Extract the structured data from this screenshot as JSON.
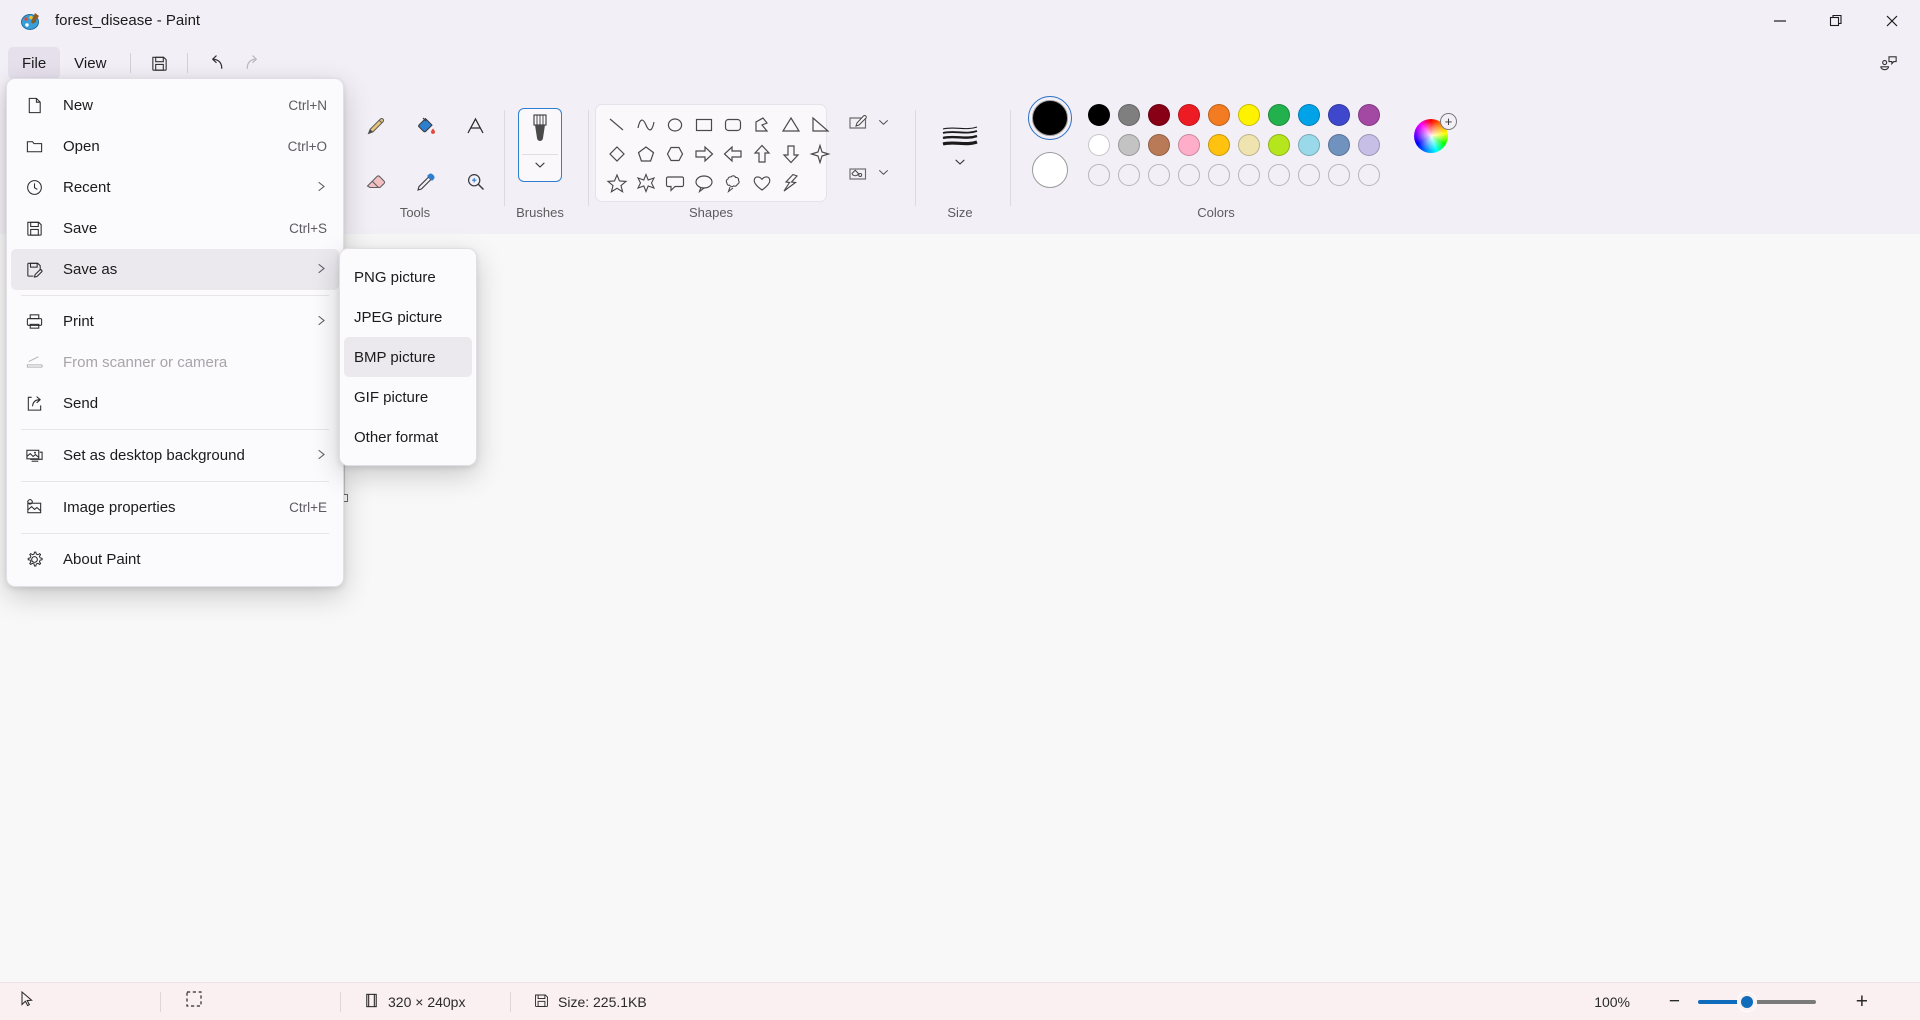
{
  "window": {
    "title": "forest_disease - Paint",
    "app_icon": "paint-palette-icon",
    "minimize": "—",
    "maximize": "❐",
    "close": "✕"
  },
  "menubar": {
    "tabs": [
      {
        "label": "File",
        "active": true
      },
      {
        "label": "View",
        "active": false
      }
    ],
    "quick_access": [
      {
        "name": "save-icon",
        "enabled": true
      },
      {
        "name": "undo-icon",
        "enabled": true
      },
      {
        "name": "redo-icon",
        "enabled": false
      }
    ],
    "feedback": "feedback-icon"
  },
  "ribbon": {
    "groups": [
      {
        "label": "Tools"
      },
      {
        "label": "Brushes"
      },
      {
        "label": "Shapes"
      },
      {
        "label": "Size"
      },
      {
        "label": "Colors"
      }
    ],
    "tools": [
      {
        "name": "pencil-icon",
        "label": "Pencil"
      },
      {
        "name": "fill-bucket-icon",
        "label": "Fill with color"
      },
      {
        "name": "text-icon",
        "label": "Text"
      },
      {
        "name": "eraser-icon",
        "label": "Eraser"
      },
      {
        "name": "color-picker-icon",
        "label": "Color picker"
      },
      {
        "name": "magnifier-icon",
        "label": "Magnifier"
      }
    ],
    "brushes": {
      "name": "brush-icon",
      "label": "Brushes",
      "expand": "chevron-down-icon"
    },
    "shapes": [
      "line",
      "curve",
      "oval",
      "rectangle",
      "rounded-rectangle",
      "polygon",
      "triangle",
      "right-triangle",
      "diamond",
      "pentagon",
      "hexagon",
      "right-arrow",
      "left-arrow",
      "up-arrow",
      "down-arrow",
      "four-point-star",
      "five-point-star",
      "six-point-star",
      "rounded-callout",
      "oval-callout",
      "cloud-callout",
      "heart",
      "lightning"
    ],
    "shape_options": [
      {
        "name": "outline-icon",
        "expand": "chevron-down-icon"
      },
      {
        "name": "fill-icon",
        "expand": "chevron-down-icon"
      }
    ],
    "size": {
      "name": "size-icon",
      "expand": "chevron-down-icon",
      "label": "Size"
    },
    "colors": {
      "primary": "#000000",
      "secondary": "#ffffff",
      "row1": [
        "#000000",
        "#7f7f7f",
        "#880015",
        "#ed1c24",
        "#f37b21",
        "#fff200",
        "#22b14c",
        "#00a2e8",
        "#3f48cc",
        "#a349a4"
      ],
      "row2": [
        "#ffffff",
        "#c3c3c3",
        "#b97a57",
        "#ffaec9",
        "#ffc20e",
        "#efe4b0",
        "#b5e61d",
        "#99d9ea",
        "#7092be",
        "#c8bfe7"
      ],
      "row3": [
        "",
        "",
        "",
        "",
        "",
        "",
        "",
        "",
        "",
        ""
      ],
      "wheel": "color-wheel-icon",
      "wheel_plus": "+"
    }
  },
  "file_menu": {
    "items": [
      {
        "label": "New",
        "accel": "Ctrl+N",
        "icon": "new-file-icon",
        "submenu": false,
        "disabled": false,
        "selected": false
      },
      {
        "label": "Open",
        "accel": "Ctrl+O",
        "icon": "open-folder-icon",
        "submenu": false,
        "disabled": false,
        "selected": false
      },
      {
        "label": "Recent",
        "accel": "",
        "icon": "clock-icon",
        "submenu": true,
        "disabled": false,
        "selected": false
      },
      {
        "label": "Save",
        "accel": "Ctrl+S",
        "icon": "save-disk-icon",
        "submenu": false,
        "disabled": false,
        "selected": false
      },
      {
        "label": "Save as",
        "accel": "",
        "icon": "save-as-icon",
        "submenu": true,
        "disabled": false,
        "selected": true
      },
      {
        "label": "Print",
        "accel": "",
        "icon": "printer-icon",
        "submenu": true,
        "disabled": false,
        "selected": false
      },
      {
        "label": "From scanner or camera",
        "accel": "",
        "icon": "scanner-icon",
        "submenu": false,
        "disabled": true,
        "selected": false
      },
      {
        "label": "Send",
        "accel": "",
        "icon": "share-icon",
        "submenu": false,
        "disabled": false,
        "selected": false
      },
      {
        "label": "Set as desktop background",
        "accel": "",
        "icon": "desktop-image-icon",
        "submenu": true,
        "disabled": false,
        "selected": false
      },
      {
        "label": "Image properties",
        "accel": "Ctrl+E",
        "icon": "image-properties-icon",
        "submenu": false,
        "disabled": false,
        "selected": false
      },
      {
        "label": "About Paint",
        "accel": "",
        "icon": "gear-icon",
        "submenu": false,
        "disabled": false,
        "selected": false
      }
    ],
    "dividers_after": [
      4,
      7,
      8,
      9
    ]
  },
  "save_as_submenu": {
    "items": [
      {
        "label": "PNG picture",
        "selected": false
      },
      {
        "label": "JPEG picture",
        "selected": false
      },
      {
        "label": "BMP picture",
        "selected": true
      },
      {
        "label": "GIF picture",
        "selected": false
      },
      {
        "label": "Other format",
        "selected": false
      }
    ]
  },
  "statusbar": {
    "cursor_icon": "cursor-arrow-icon",
    "selection_icon": "selection-dashed-icon",
    "dimensions_icon": "canvas-size-icon",
    "dimensions": "320 × 240px",
    "filesize_icon": "save-disk-icon",
    "filesize": "Size: 225.1KB",
    "zoom_level": "100%",
    "zoom_out": "−",
    "zoom_in": "+"
  }
}
